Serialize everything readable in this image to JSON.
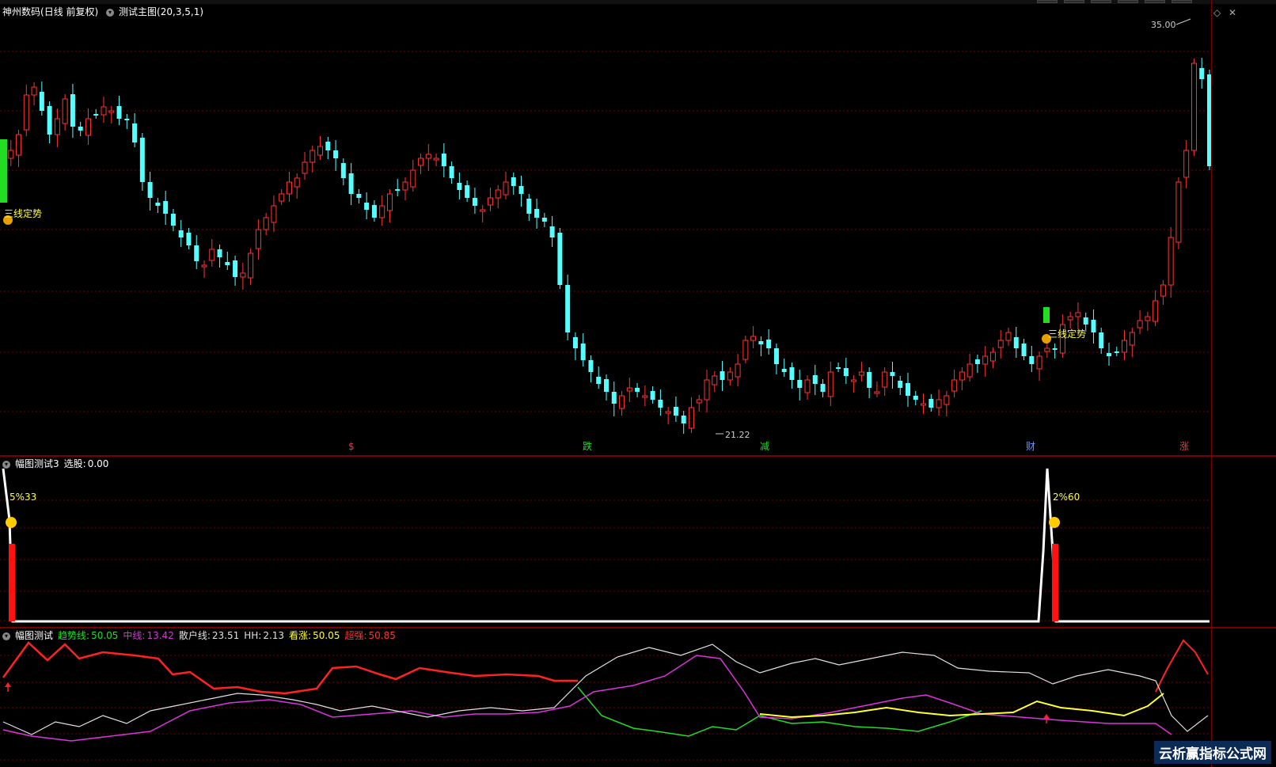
{
  "header_main": {
    "stock_name": "神州数码",
    "period": "(日线 前复权)",
    "indicator": "测试主图",
    "params": "(20,3,5,1)"
  },
  "main_annotations": {
    "high_label": "35.00",
    "low_label": "21.22",
    "signal_label": "三线定势",
    "bottom_markers": [
      "$",
      "跌",
      "减",
      "财",
      "涨"
    ],
    "bottom_marker_colors": [
      "#ff3333",
      "#22dd22",
      "#22dd22",
      "#6699ff",
      "#ff3333"
    ]
  },
  "sub1": {
    "title": "幅图测试3",
    "value_label": "选股:",
    "value": "0.00",
    "label_left": "5%33",
    "label_right": "2%60"
  },
  "sub2": {
    "title": "幅图测试",
    "items": [
      {
        "label": "趋势线:",
        "value": "50.05",
        "color": "#22dd22"
      },
      {
        "label": "中线:",
        "value": "13.42",
        "color": "#dd33dd"
      },
      {
        "label": "散户线:",
        "value": "23.51",
        "color": "#e0e0e0"
      },
      {
        "label": "HH:",
        "value": "2.13",
        "color": "#e0e0e0"
      },
      {
        "label": "看涨:",
        "value": "50.05",
        "color": "#ffff33"
      },
      {
        "label": "超强:",
        "value": "50.85",
        "color": "#ff3333"
      }
    ]
  },
  "watermark": "云析赢指标公式网",
  "colors": {
    "up": "#ff3333",
    "down": "#55ffff",
    "grid": "#7a0000",
    "signal_green": "#22dd22"
  }
}
